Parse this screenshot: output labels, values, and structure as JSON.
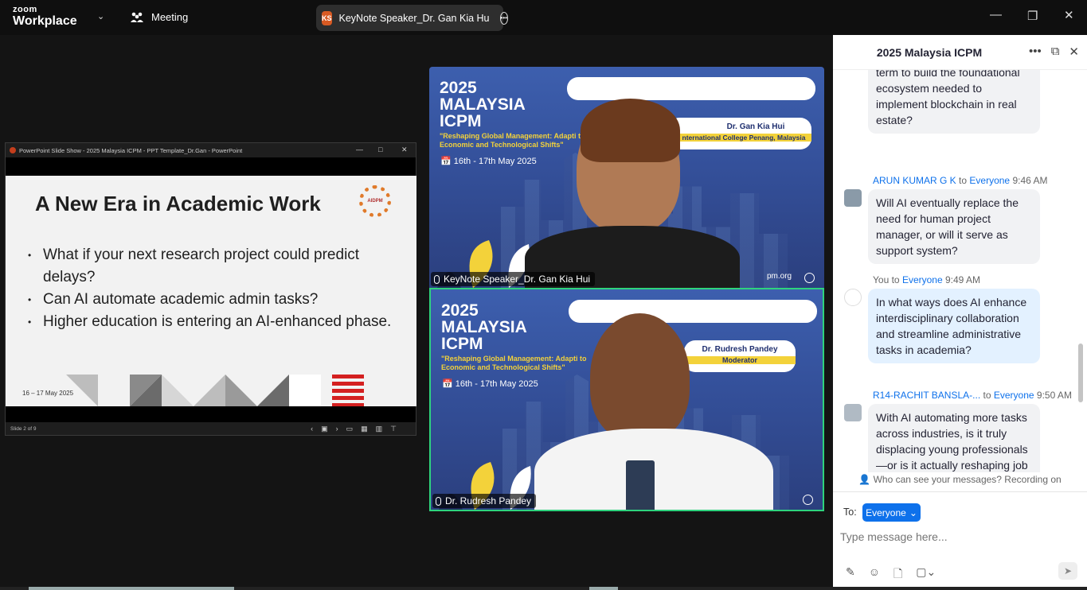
{
  "app": {
    "brand_top": "zoom",
    "brand_bottom": "Workplace",
    "meeting_label": "Meeting"
  },
  "active_speaker": {
    "initials": "KS",
    "name": "KeyNote Speaker_Dr. Gan Kia Hu"
  },
  "ppt": {
    "window_title": "PowerPoint Slide Show  -  2025 Malaysia ICPM - PPT Template_Dr.Gan  -  PowerPoint",
    "slide_title": "A New Era in Academic Work",
    "logo_text": "AIDPM",
    "bullets": [
      "What if your next research project could predict delays?",
      "Can AI automate academic admin tasks?",
      "Higher education is entering an AI-enhanced phase."
    ],
    "date": "16 – 17 May 2025",
    "status": "Slide 2 of 9"
  },
  "event": {
    "title_line1": "2025",
    "title_line2": "MALAYSIA",
    "title_line3": "ICPM",
    "subtitle": "\"Reshaping Global Management: Adapti to Economic and Technological Shifts\"",
    "date": "16th - 17th May 2025"
  },
  "tiles": [
    {
      "badge_name": "Dr. Gan Kia Hui",
      "badge_role": "nternational College Penang, Malaysia",
      "label": "KeyNote Speaker_Dr. Gan Kia Hui",
      "url_fragment": "pm.org"
    },
    {
      "badge_name": "Dr. Rudresh Pandey",
      "badge_role": "Moderator",
      "label": "Dr. Rudresh Pandey"
    }
  ],
  "chat": {
    "title": "2025 Malaysia ICPM",
    "messages": [
      {
        "sender": "",
        "to": "",
        "time": "",
        "text": "term to build the foundational ecosystem needed to implement blockchain in real estate?"
      },
      {
        "sender": "ARUN KUMAR G K",
        "to": "Everyone",
        "time": "9:46 AM",
        "text": "Will AI eventually replace the need for human project manager, or will it serve as support system?"
      },
      {
        "sender": "You",
        "to": "Everyone",
        "time": "9:49 AM",
        "text": "In what ways does AI enhance interdisciplinary collaboration and streamline administrative tasks in academia?"
      },
      {
        "sender": "R14-RACHIT BANSLA-...",
        "to": "Everyone",
        "time": "9:50 AM",
        "text": "With AI automating more tasks across industries, is it truly displacing young professionals—or is it actually reshaping job roles and creating new"
      }
    ],
    "visibility_note": "Who can see your messages? Recording on",
    "to_label": "To:",
    "to_value": "Everyone",
    "input_placeholder": "Type message here..."
  },
  "colors": {
    "accent": "#0e71eb",
    "active_border": "#2ed37d",
    "event_bg": "#34509a",
    "event_yellow": "#f3d23a"
  }
}
